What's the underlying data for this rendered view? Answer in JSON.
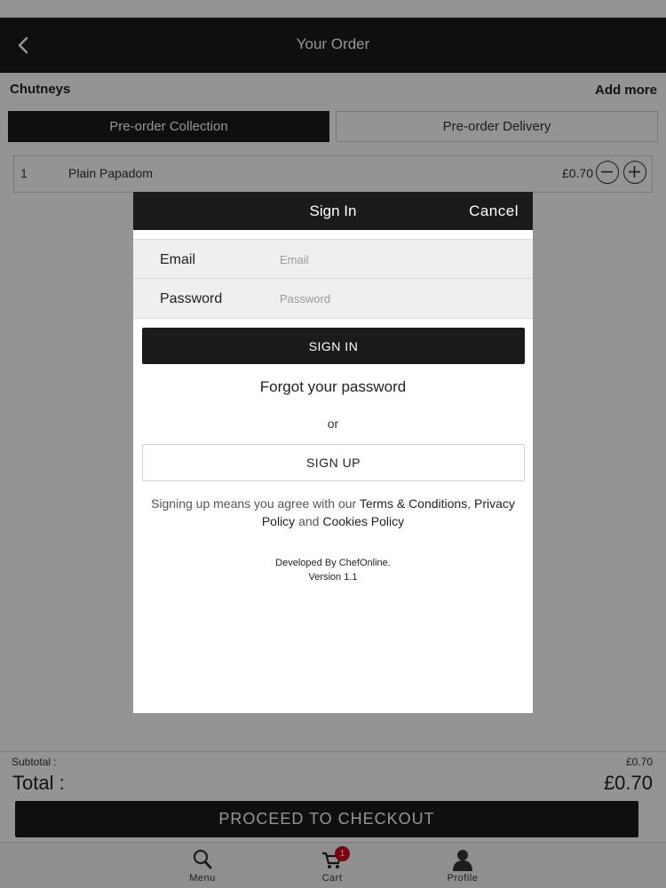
{
  "nav": {
    "title": "Your Order",
    "back_icon": "chevron-left-icon"
  },
  "restaurant": {
    "name": "Chutneys",
    "add_more": "Add more"
  },
  "tabs": {
    "collection": "Pre-order Collection",
    "delivery": "Pre-order Delivery",
    "active": "collection"
  },
  "order": {
    "items": [
      {
        "qty": "1",
        "name": "Plain Papadom",
        "price": "£0.70"
      }
    ]
  },
  "summary": {
    "subtotal_label": "Subtotal :",
    "subtotal_value": "£0.70",
    "total_label": "Total :",
    "total_value": "£0.70"
  },
  "checkout": {
    "label": "PROCEED TO CHECKOUT"
  },
  "tabbar": {
    "items": [
      {
        "label": "Menu",
        "icon": "search-icon"
      },
      {
        "label": "Cart",
        "icon": "cart-icon",
        "badge": "1"
      },
      {
        "label": "Profile",
        "icon": "profile-icon"
      }
    ]
  },
  "modal": {
    "title": "Sign In",
    "cancel": "Cancel",
    "email_label": "Email",
    "email_placeholder": "Email",
    "email_value": "",
    "password_label": "Password",
    "password_placeholder": "Password",
    "password_value": "",
    "signin_label": "SIGN IN",
    "forgot": "Forgot your password",
    "or": "or",
    "signup_label": "SIGN UP",
    "terms_prefix": "Signing up means you agree with our ",
    "terms_link": "Terms & Conditions",
    "terms_sep": ", ",
    "privacy_link": "Privacy Policy",
    "terms_and": " and ",
    "cookies_link": "Cookies Policy",
    "developed_by": "Developed By ChefOnline.",
    "version": "Version 1.1"
  },
  "colors": {
    "dark": "#1b1b1b",
    "badge": "#d0021b",
    "overlay": "rgba(0,0,0,0.42)"
  }
}
